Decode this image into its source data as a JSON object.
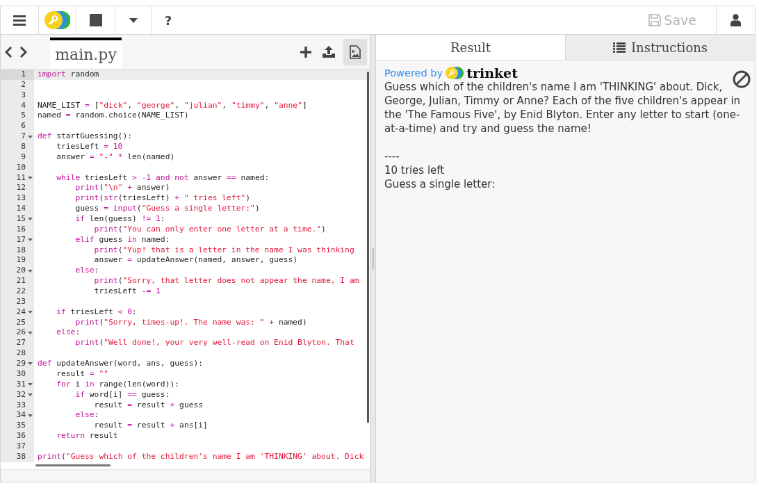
{
  "toolbar": {
    "help": "?",
    "save": {
      "label": "Save",
      "disabled": true
    }
  },
  "editor": {
    "file_tab": {
      "label": "main.py",
      "selected": true
    },
    "lines": [
      {
        "number": "1",
        "active": true,
        "fold": false,
        "tokens": [
          {
            "text": "import",
            "kind": "kw"
          },
          {
            "text": " random",
            "kind": "plain"
          }
        ]
      },
      {
        "number": "2",
        "active": false,
        "fold": false
      },
      {
        "number": "3",
        "active": false,
        "fold": false
      },
      {
        "number": "4",
        "active": false,
        "fold": false,
        "tokens": [
          {
            "text": "NAME_LIST ",
            "kind": "plain"
          },
          {
            "text": "=",
            "kind": "op"
          },
          {
            "text": " [",
            "kind": "plain"
          },
          {
            "text": "\"dick\"",
            "kind": "str"
          },
          {
            "text": ", ",
            "kind": "plain"
          },
          {
            "text": "\"george\"",
            "kind": "str"
          },
          {
            "text": ", ",
            "kind": "plain"
          },
          {
            "text": "\"julian\"",
            "kind": "str"
          },
          {
            "text": ", ",
            "kind": "plain"
          },
          {
            "text": "\"timmy\"",
            "kind": "str"
          },
          {
            "text": ", ",
            "kind": "plain"
          },
          {
            "text": "\"anne\"",
            "kind": "str"
          },
          {
            "text": "]",
            "kind": "plain"
          }
        ]
      },
      {
        "number": "5",
        "active": false,
        "fold": false,
        "tokens": [
          {
            "text": "named ",
            "kind": "plain"
          },
          {
            "text": "=",
            "kind": "op"
          },
          {
            "text": " random.choice(NAME_LIST)",
            "kind": "plain"
          }
        ]
      },
      {
        "number": "6",
        "active": false,
        "fold": false
      },
      {
        "number": "7",
        "active": false,
        "fold": true,
        "tokens": [
          {
            "text": "def",
            "kind": "kw"
          },
          {
            "text": " startGuessing():",
            "kind": "plain"
          }
        ]
      },
      {
        "number": "8",
        "active": false,
        "fold": false,
        "tokens": [
          {
            "text": "    triesLeft ",
            "kind": "plain"
          },
          {
            "text": "= 10",
            "kind": "op"
          }
        ]
      },
      {
        "number": "9",
        "active": false,
        "fold": false,
        "tokens": [
          {
            "text": "    answer ",
            "kind": "plain"
          },
          {
            "text": "= ",
            "kind": "op"
          },
          {
            "text": "\"-\"",
            "kind": "str"
          },
          {
            "text": " *",
            "kind": "op"
          },
          {
            "text": " len(named)",
            "kind": "plain"
          }
        ]
      },
      {
        "number": "10",
        "active": false,
        "fold": false
      },
      {
        "number": "11",
        "active": false,
        "fold": true,
        "tokens": [
          {
            "text": "    while",
            "kind": "kw"
          },
          {
            "text": " triesLeft ",
            "kind": "plain"
          },
          {
            "text": "> -1 and not",
            "kind": "op"
          },
          {
            "text": " answer ",
            "kind": "plain"
          },
          {
            "text": "==",
            "kind": "op"
          },
          {
            "text": " named:",
            "kind": "plain"
          }
        ]
      },
      {
        "number": "12",
        "active": false,
        "fold": false,
        "tokens": [
          {
            "text": "        print",
            "kind": "kw"
          },
          {
            "text": "(",
            "kind": "plain"
          },
          {
            "text": "\"\\n\"",
            "kind": "str"
          },
          {
            "text": " +",
            "kind": "op"
          },
          {
            "text": " answer)",
            "kind": "plain"
          }
        ]
      },
      {
        "number": "13",
        "active": false,
        "fold": false,
        "tokens": [
          {
            "text": "        print",
            "kind": "kw"
          },
          {
            "text": "(",
            "kind": "plain"
          },
          {
            "text": "str",
            "kind": "kw"
          },
          {
            "text": "(triesLeft) ",
            "kind": "plain"
          },
          {
            "text": "+ ",
            "kind": "op"
          },
          {
            "text": "\" tries left\"",
            "kind": "str"
          },
          {
            "text": ")",
            "kind": "plain"
          }
        ]
      },
      {
        "number": "14",
        "active": false,
        "fold": false,
        "tokens": [
          {
            "text": "        guess ",
            "kind": "plain"
          },
          {
            "text": "= input",
            "kind": "op"
          },
          {
            "text": "(",
            "kind": "plain"
          },
          {
            "text": "\"Guess a single letter:\"",
            "kind": "str"
          },
          {
            "text": ")",
            "kind": "plain"
          }
        ]
      },
      {
        "number": "15",
        "active": false,
        "fold": true,
        "tokens": [
          {
            "text": "        if",
            "kind": "kw"
          },
          {
            "text": " len(guess) ",
            "kind": "plain"
          },
          {
            "text": "!= 1",
            "kind": "op"
          },
          {
            "text": ":",
            "kind": "plain"
          }
        ]
      },
      {
        "number": "16",
        "active": false,
        "fold": false,
        "tokens": [
          {
            "text": "            print",
            "kind": "kw"
          },
          {
            "text": "(",
            "kind": "plain"
          },
          {
            "text": "\"You can only enter one letter at a time.\"",
            "kind": "str"
          },
          {
            "text": ")",
            "kind": "plain"
          }
        ]
      },
      {
        "number": "17",
        "active": false,
        "fold": true,
        "tokens": [
          {
            "text": "        elif",
            "kind": "kw"
          },
          {
            "text": " guess ",
            "kind": "plain"
          },
          {
            "text": "in",
            "kind": "kw"
          },
          {
            "text": " named:",
            "kind": "plain"
          }
        ]
      },
      {
        "number": "18",
        "active": false,
        "fold": false,
        "tokens": [
          {
            "text": "            print",
            "kind": "kw"
          },
          {
            "text": "(",
            "kind": "plain"
          },
          {
            "text": "\"Yup! that is a letter in the name I was thinking",
            "kind": "str"
          }
        ]
      },
      {
        "number": "19",
        "active": false,
        "fold": false,
        "tokens": [
          {
            "text": "            answer ",
            "kind": "plain"
          },
          {
            "text": "=",
            "kind": "op"
          },
          {
            "text": " updateAnswer(named, answer, guess)",
            "kind": "plain"
          }
        ]
      },
      {
        "number": "20",
        "active": false,
        "fold": true,
        "tokens": [
          {
            "text": "        else",
            "kind": "kw"
          },
          {
            "text": ":",
            "kind": "plain"
          }
        ]
      },
      {
        "number": "21",
        "active": false,
        "fold": false,
        "tokens": [
          {
            "text": "            print",
            "kind": "kw"
          },
          {
            "text": "(",
            "kind": "plain"
          },
          {
            "text": "\"Sorry, that letter does not appear the name, I am",
            "kind": "str"
          }
        ]
      },
      {
        "number": "22",
        "active": false,
        "fold": false,
        "tokens": [
          {
            "text": "            triesLeft ",
            "kind": "plain"
          },
          {
            "text": "-= 1",
            "kind": "op"
          }
        ]
      },
      {
        "number": "23",
        "active": false,
        "fold": false
      },
      {
        "number": "24",
        "active": false,
        "fold": true,
        "tokens": [
          {
            "text": "    if",
            "kind": "kw"
          },
          {
            "text": " triesLeft ",
            "kind": "plain"
          },
          {
            "text": "< 0",
            "kind": "op"
          },
          {
            "text": ":",
            "kind": "plain"
          }
        ]
      },
      {
        "number": "25",
        "active": false,
        "fold": false,
        "tokens": [
          {
            "text": "        print",
            "kind": "kw"
          },
          {
            "text": "(",
            "kind": "plain"
          },
          {
            "text": "\"Sorry, times-up!. The name was: \"",
            "kind": "str"
          },
          {
            "text": " +",
            "kind": "op"
          },
          {
            "text": " named)",
            "kind": "plain"
          }
        ]
      },
      {
        "number": "26",
        "active": false,
        "fold": true,
        "tokens": [
          {
            "text": "    else",
            "kind": "kw"
          },
          {
            "text": ":",
            "kind": "plain"
          }
        ]
      },
      {
        "number": "27",
        "active": false,
        "fold": false,
        "tokens": [
          {
            "text": "        print",
            "kind": "kw"
          },
          {
            "text": "(",
            "kind": "plain"
          },
          {
            "text": "\"Well done!, your very well-read on Enid Blyton. That",
            "kind": "str"
          }
        ]
      },
      {
        "number": "28",
        "active": false,
        "fold": false
      },
      {
        "number": "29",
        "active": false,
        "fold": true,
        "tokens": [
          {
            "text": "def",
            "kind": "kw"
          },
          {
            "text": " updateAnswer(word, ans, guess):",
            "kind": "plain"
          }
        ]
      },
      {
        "number": "30",
        "active": false,
        "fold": false,
        "tokens": [
          {
            "text": "    result ",
            "kind": "plain"
          },
          {
            "text": "= ",
            "kind": "op"
          },
          {
            "text": "\"\"",
            "kind": "str"
          }
        ]
      },
      {
        "number": "31",
        "active": false,
        "fold": true,
        "tokens": [
          {
            "text": "    for",
            "kind": "kw"
          },
          {
            "text": " i ",
            "kind": "plain"
          },
          {
            "text": "in",
            "kind": "kw"
          },
          {
            "text": " range(len(word)):",
            "kind": "plain"
          }
        ]
      },
      {
        "number": "32",
        "active": false,
        "fold": true,
        "tokens": [
          {
            "text": "        if",
            "kind": "kw"
          },
          {
            "text": " word[i] ",
            "kind": "plain"
          },
          {
            "text": "==",
            "kind": "op"
          },
          {
            "text": " guess:",
            "kind": "plain"
          }
        ]
      },
      {
        "number": "33",
        "active": false,
        "fold": false,
        "tokens": [
          {
            "text": "            result ",
            "kind": "plain"
          },
          {
            "text": "=",
            "kind": "op"
          },
          {
            "text": " result ",
            "kind": "plain"
          },
          {
            "text": "+",
            "kind": "op"
          },
          {
            "text": " guess",
            "kind": "plain"
          }
        ]
      },
      {
        "number": "34",
        "active": false,
        "fold": true,
        "tokens": [
          {
            "text": "        else",
            "kind": "kw"
          },
          {
            "text": ":",
            "kind": "plain"
          }
        ]
      },
      {
        "number": "35",
        "active": false,
        "fold": false,
        "tokens": [
          {
            "text": "            result ",
            "kind": "plain"
          },
          {
            "text": "=",
            "kind": "op"
          },
          {
            "text": " result ",
            "kind": "plain"
          },
          {
            "text": "+",
            "kind": "op"
          },
          {
            "text": " ans[i]",
            "kind": "plain"
          }
        ]
      },
      {
        "number": "36",
        "active": false,
        "fold": false,
        "tokens": [
          {
            "text": "    return",
            "kind": "kw"
          },
          {
            "text": " result",
            "kind": "plain"
          }
        ]
      },
      {
        "number": "37",
        "active": false,
        "fold": false
      },
      {
        "number": "38",
        "active": false,
        "fold": false,
        "tokens": [
          {
            "text": "print",
            "kind": "kw"
          },
          {
            "text": "(",
            "kind": "plain"
          },
          {
            "text": "\"Guess which of the children's name I am 'THINKING' about. Dick",
            "kind": "str"
          }
        ]
      }
    ]
  },
  "output": {
    "tabs": [
      {
        "label": "Result",
        "selected": true
      },
      {
        "label": "Instructions",
        "selected": false
      }
    ],
    "powered_by": "Powered by",
    "brand": "trinket",
    "intro": "Guess which of the children's name I am 'THINKING' about. Dick, George, Julian, Timmy or Anne? Each of the five children's appear in the 'The Famous Five', by Enid Blyton. Enter any letter to start (one-at-a-time) and try and guess the name!",
    "lines": [
      "----",
      "10 tries left",
      "Guess a single letter:"
    ]
  }
}
